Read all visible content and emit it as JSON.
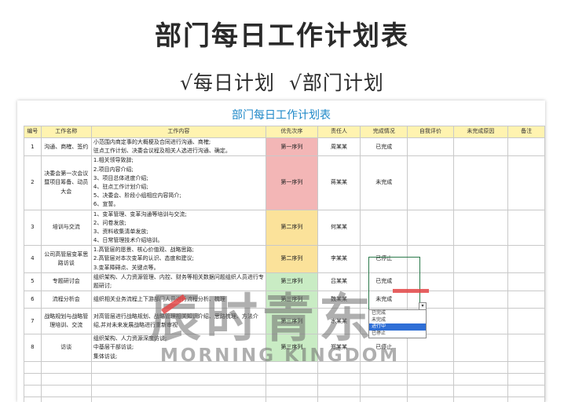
{
  "banner": {
    "title": "部门每日工作计划表",
    "subtitle_left": "√每日计划",
    "subtitle_right": "√部门计划"
  },
  "sheet": {
    "title": "部门每日工作计划表",
    "headers": [
      "编号",
      "工作名称",
      "工作内容",
      "优先次序",
      "责任人",
      "完成情况",
      "自我评价",
      "未完成原因",
      "备注"
    ],
    "rows": [
      {
        "no": "1",
        "name": "沟通、商榷、签约",
        "content": [
          "小范围内商定事的大概梗及合同进行沟通、商榷;",
          "驻点工作计划、决委会议程及相关人选进行沟通、确定。"
        ],
        "priority": "第一序列",
        "priority_level": 1,
        "owner": "周某某",
        "status": "已完成"
      },
      {
        "no": "2",
        "name": "决委会第一次会议暨项目筹备、动员大会",
        "content": [
          "1.相关领导致辞;",
          "2.项目内容介绍;",
          "3、项目总体进度介绍;",
          "4、驻点工作计划介绍;",
          "5、决委会、阶段小组相应内容简介;",
          "6、宣誓。"
        ],
        "priority": "第一序列",
        "priority_level": 1,
        "owner": "蒋某某",
        "status": "未完成"
      },
      {
        "no": "3",
        "name": "培训与交流",
        "content": [
          "1、变革管理、变革沟通等培训与交流;",
          "2、问卷发放;",
          "3、资料收集清单发放;",
          "4、日常管理技术介绍培训。"
        ],
        "priority": "第二序列",
        "priority_level": 2,
        "owner": "何某某",
        "status": ""
      },
      {
        "no": "4",
        "name": "公司高管层变革思路访谈",
        "content": [
          "1.高管层的愿景、核心价值观、战略思路;",
          "2.高管层对本次变革的认识、态度和建议;",
          "3.变革障碍点、关键点等。"
        ],
        "priority": "第二序列",
        "priority_level": 2,
        "owner": "李某某",
        "status": "已停止"
      },
      {
        "no": "5",
        "name": "专题研讨会",
        "content": [
          "组织架构、人力资源管理、内控、财务等相关数据问题组织人员进行专",
          "题研讨;"
        ],
        "priority": "第三序列",
        "priority_level": 3,
        "owner": "吕某某",
        "status": "已完成"
      },
      {
        "no": "6",
        "name": "流程分析会",
        "content": [
          "组织相关业务流程上下游部门人员进行流程分析、梳理"
        ],
        "priority": "第三序列",
        "priority_level": 3,
        "owner": "魏某某",
        "status": "未完成"
      },
      {
        "no": "7",
        "name": "战略规划与战略管理培训、交流",
        "content": [
          "对高管层进行战略规划、战略管理相关知识介绍、思路梳理、方法介",
          "绍,并对未来发展战略进行重新审视"
        ],
        "priority": "第三序列",
        "priority_level": 3,
        "owner": "水某某",
        "status": "进行中"
      },
      {
        "no": "8",
        "name": "访谈",
        "content": [
          "组织架构、人力资源深度访谈;",
          "中基层干部访谈;",
          "集体访谈;"
        ],
        "priority": "第三序列",
        "priority_level": 3,
        "owner": "郑某某",
        "status": "已停止"
      }
    ],
    "dropdown_options": [
      "已完成",
      "未完成",
      "进行中",
      "已停止"
    ],
    "dropdown_selected": "进行中"
  },
  "watermark": {
    "text_cn": "辰时青东",
    "text_en": "MORNING KINGDOM"
  },
  "colors": {
    "priority_1": "#f3b6b6",
    "priority_2": "#fbe29a",
    "priority_3": "#c9ecc4",
    "header_bg": "#fff3b0",
    "sheet_title": "#1e88c8",
    "dropdown_selected": "#2f6fd6"
  }
}
